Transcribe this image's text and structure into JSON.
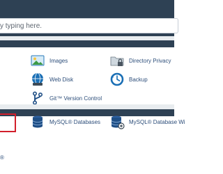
{
  "search": {
    "visible_text": "y typing here."
  },
  "tools": {
    "images": "Images",
    "directory_privacy": "Directory Privacy",
    "web_disk": "Web Disk",
    "backup": "Backup",
    "git_version_control": "Git™ Version Control"
  },
  "databases": {
    "mysql_databases": "MySQL® Databases",
    "mysql_database_wizard": "MySQL® Database Wi",
    "left_fragment": "®"
  },
  "icons": {
    "images": "image-gallery-icon",
    "directory_privacy": "folder-lock-icon",
    "web_disk": "globe-drive-icon",
    "backup": "clock-backup-icon",
    "git": "git-branch-icon",
    "mysql": "database-icon",
    "mysql_wizard": "database-wand-icon"
  },
  "colors": {
    "header_bg": "#2e4154",
    "link_text": "#2d4e7a",
    "highlight_border": "#d21f2b",
    "icon_blue": "#1a6fb5"
  }
}
